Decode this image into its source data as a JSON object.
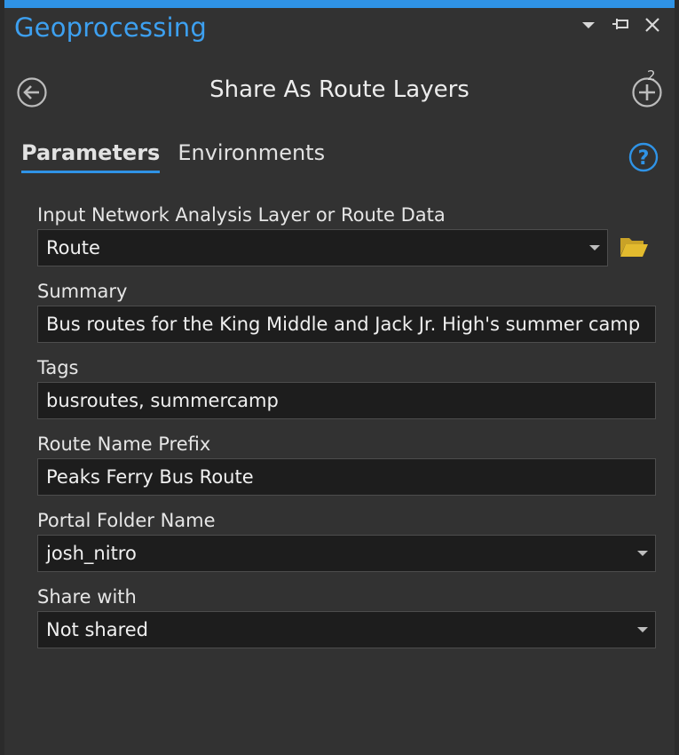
{
  "pane": {
    "title": "Geoprocessing",
    "accent_color": "#2f93e6",
    "controls": {
      "menu_icon": "chevron-down-icon",
      "pin_icon": "pin-icon",
      "close_icon": "close-icon"
    }
  },
  "tool": {
    "title": "Share As Route Layers",
    "back_icon": "back-arrow-icon",
    "add_icon": "add-circle-icon",
    "add_count": "2"
  },
  "tabs": {
    "parameters_label": "Parameters",
    "environments_label": "Environments",
    "active": "parameters",
    "help_icon": "help-icon"
  },
  "fields": {
    "input_layer": {
      "label": "Input Network Analysis Layer or Route Data",
      "value": "Route",
      "folder_icon": "folder-open-icon"
    },
    "summary": {
      "label": "Summary",
      "value": "Bus routes for the King Middle and Jack Jr. High's summer camp"
    },
    "tags": {
      "label": "Tags",
      "value": "busroutes, summercamp"
    },
    "route_name_prefix": {
      "label": "Route Name Prefix",
      "value": "Peaks Ferry Bus Route"
    },
    "portal_folder_name": {
      "label": "Portal Folder Name",
      "value": "josh_nitro"
    },
    "share_with": {
      "label": "Share with",
      "value": "Not shared"
    }
  }
}
